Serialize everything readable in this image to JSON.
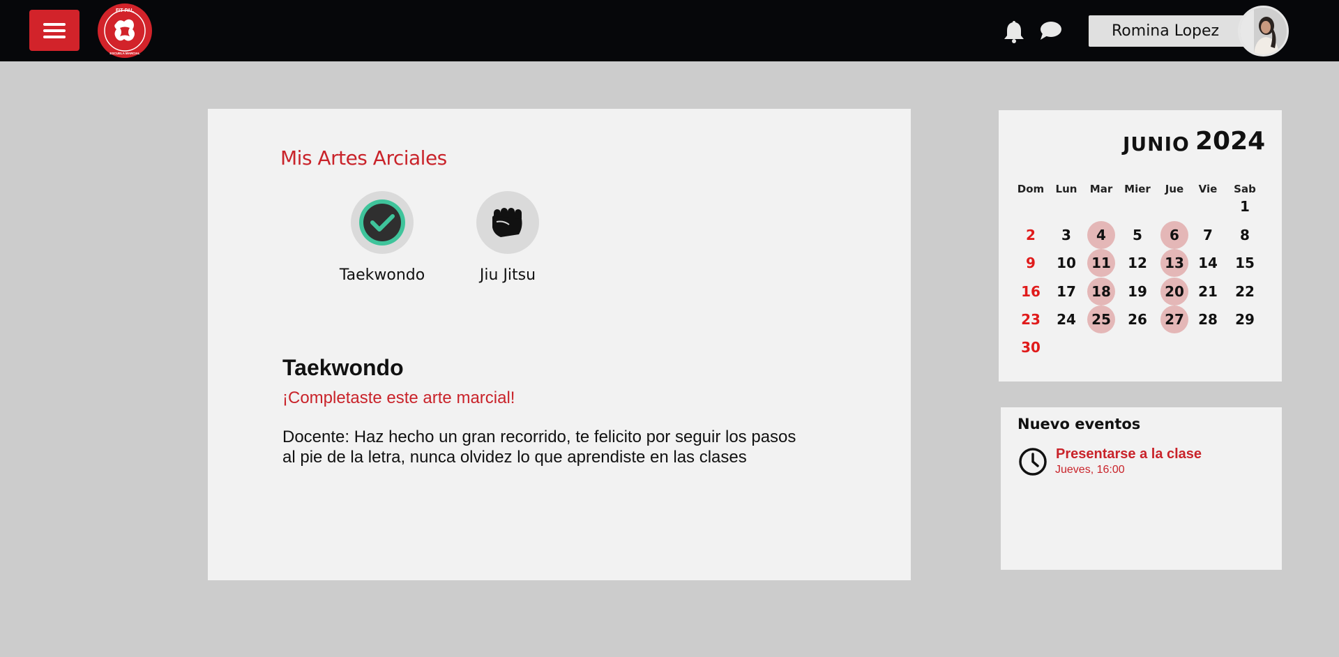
{
  "header": {
    "logo_text_top": "FIT PAL",
    "logo_text_bottom": "ESCUELA MARCIAL",
    "user_name": "Romina Lopez"
  },
  "arts": {
    "title": "Mis Artes Arciales",
    "items": [
      {
        "label": "Taekwondo",
        "icon": "check-icon",
        "completed": true
      },
      {
        "label": "Jiu Jitsu",
        "icon": "fist-icon",
        "completed": false
      }
    ]
  },
  "detail": {
    "title": "Taekwondo",
    "status": "¡Completaste este arte marcial!",
    "line1": "Docente: Haz hecho un gran recorrido, te felicito por seguir los pasos",
    "line2": "al pie de la letra, nunca olvidez lo que aprendiste en las clases"
  },
  "calendar": {
    "month": "JUNIO",
    "year": "2024",
    "weekdays": [
      "Dom",
      "Lun",
      "Mar",
      "Mier",
      "Jue",
      "Vie",
      "Sab"
    ],
    "weeks": [
      [
        "",
        "",
        "",
        "",
        "",
        "",
        "1"
      ],
      [
        "2",
        "3",
        "4",
        "5",
        "6",
        "7",
        "8"
      ],
      [
        "9",
        "10",
        "11",
        "12",
        "13",
        "14",
        "15"
      ],
      [
        "16",
        "17",
        "18",
        "19",
        "20",
        "21",
        "22"
      ],
      [
        "23",
        "24",
        "25",
        "26",
        "27",
        "28",
        "29"
      ],
      [
        "30",
        "",
        "",
        "",
        "",
        "",
        ""
      ]
    ],
    "highlighted_days": [
      "4",
      "6",
      "11",
      "13",
      "18",
      "20",
      "25",
      "27"
    ]
  },
  "events": {
    "title": "Nuevo eventos",
    "items": [
      {
        "name": "Presentarse a la clase",
        "time": "Jueves, 16:00"
      }
    ]
  },
  "colors": {
    "accent_red": "#c9232a",
    "check_green": "#3fc49b",
    "highlight_pink": "#e4b7b7",
    "sunday_red": "#e01b1b"
  }
}
